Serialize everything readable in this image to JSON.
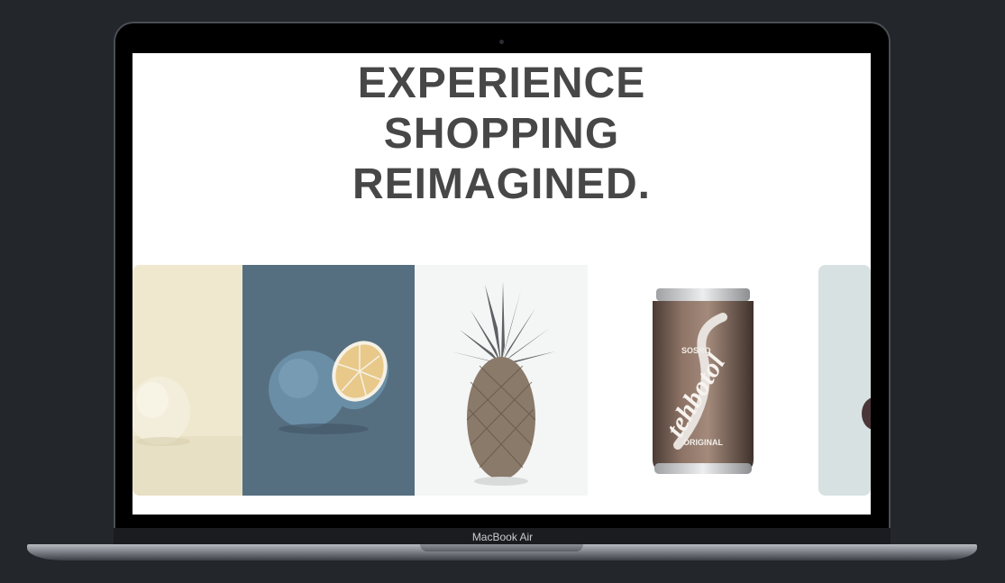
{
  "device": {
    "model_label": "MacBook Air"
  },
  "hero": {
    "headline_lines": [
      "EXPERIENCE",
      "SHOPPING",
      "REIMAGINED."
    ]
  },
  "carousel": {
    "slides": [
      {
        "subject": "white-lemon",
        "background": "#efe8cf"
      },
      {
        "subject": "blue-grapefruit",
        "background": "#566f80"
      },
      {
        "subject": "pineapple",
        "background": "#f4f5f5"
      },
      {
        "subject": "tehbotol-can",
        "background": "#ffffff"
      },
      {
        "subject": "partial-fruit",
        "background": "#d7e1e1"
      }
    ],
    "can_label": {
      "brand": "tehbotol",
      "maker": "SOSRO",
      "variant": "ORIGINAL"
    }
  }
}
